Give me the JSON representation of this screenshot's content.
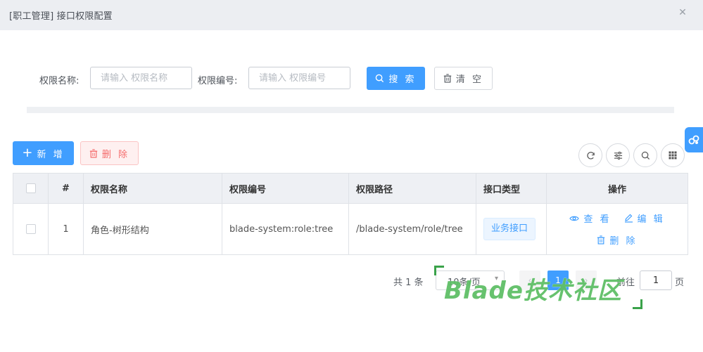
{
  "dialog": {
    "title": "[职工管理] 接口权限配置",
    "close_icon": "close-icon"
  },
  "search": {
    "name_label": "权限名称:",
    "name_placeholder": "请输入 权限名称",
    "code_label": "权限编号:",
    "code_placeholder": "请输入 权限编号",
    "search_button": "搜 索",
    "clear_button": "清 空"
  },
  "toolbar": {
    "add_button": "新 增",
    "delete_button": "删 除",
    "right_icons": [
      "refresh-icon",
      "filter-settings-icon",
      "search-icon",
      "grid-columns-icon"
    ]
  },
  "table": {
    "headers": [
      "",
      "#",
      "权限名称",
      "权限编号",
      "权限路径",
      "接口类型",
      "操作"
    ],
    "rows": [
      {
        "index": "1",
        "name": "角色-树形结构",
        "code": "blade-system:role:tree",
        "path": "/blade-system/role/tree",
        "type": "业务接口",
        "actions": {
          "view": "查 看",
          "edit": "编 辑",
          "delete": "删 除"
        }
      }
    ]
  },
  "pagination": {
    "total_text": "共 1 条",
    "page_size": "10条/页",
    "current_page": "1",
    "goto_label": "前往",
    "goto_value": "1",
    "page_unit": "页"
  },
  "watermark": {
    "text": "Blade技术社区"
  },
  "colors": {
    "primary": "#409eff",
    "danger": "#f56c6c",
    "watermark": "#5fbf67"
  }
}
